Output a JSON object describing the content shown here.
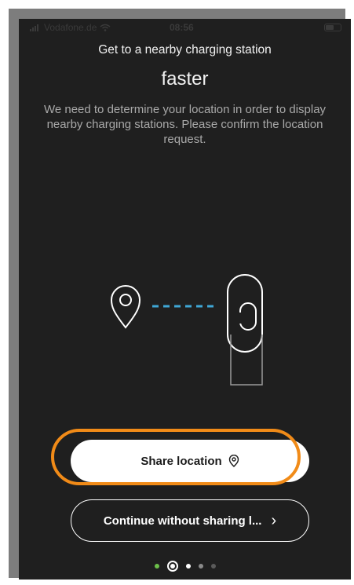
{
  "status_bar": {
    "carrier": "Vodafone.de",
    "time": "08:56"
  },
  "header": {
    "subtitle": "Get to a nearby charging station",
    "title": "faster",
    "description": "We need to determine your location in order to display nearby charging stations. Please confirm the location request."
  },
  "actions": {
    "share_label": "Share location",
    "continue_label": "Continue without sharing l...",
    "continue_chevron": "›"
  },
  "pager": {
    "total": 5,
    "active_index": 1
  },
  "colors": {
    "background": "#1f1f1f",
    "accent_highlight": "#f18b18",
    "dash_blue": "#3fa7d6",
    "dot_green": "#6cc04a"
  },
  "icons": [
    "location-pin-icon",
    "charger-plug-icon",
    "chevron-right-icon",
    "wifi-icon",
    "signal-icon",
    "battery-icon"
  ]
}
